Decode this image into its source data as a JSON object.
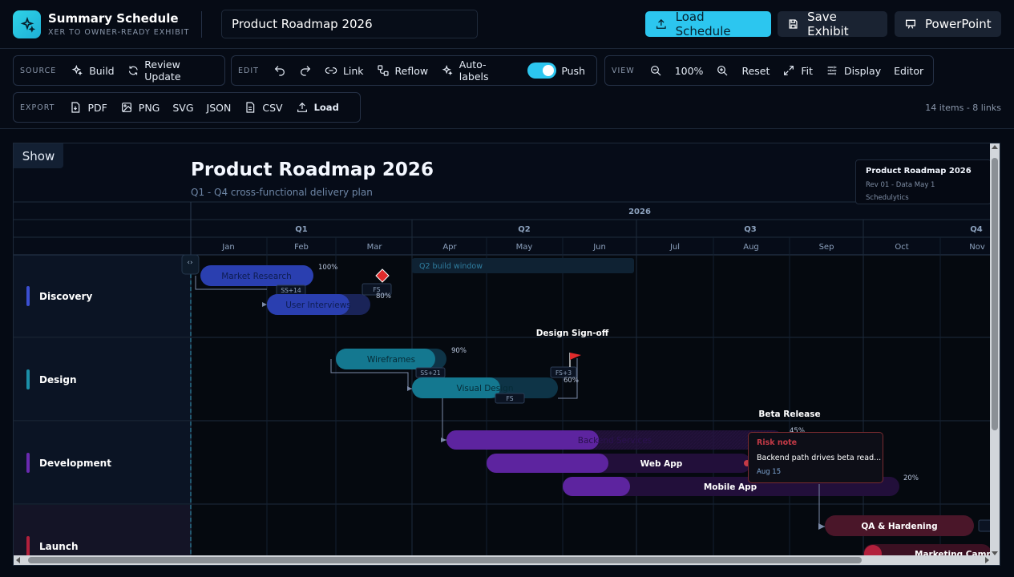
{
  "app": {
    "title": "Summary Schedule",
    "subtitle": "XER TO OWNER-READY EXHIBIT"
  },
  "header": {
    "title_value": "Product Roadmap 2026",
    "load_label": "Load Schedule",
    "save_label": "Save Exhibit",
    "ppt_label": "PowerPoint"
  },
  "toolbar": {
    "source": {
      "label": "SOURCE",
      "build": "Build",
      "review": "Review Update"
    },
    "edit": {
      "label": "EDIT",
      "link": "Link",
      "reflow": "Reflow",
      "autolabels": "Auto-labels",
      "push": "Push"
    },
    "view": {
      "label": "VIEW",
      "zoom": "100%",
      "reset": "Reset",
      "fit": "Fit",
      "display": "Display",
      "editor": "Editor"
    },
    "export": {
      "label": "EXPORT",
      "pdf": "PDF",
      "png": "PNG",
      "svg": "SVG",
      "json": "JSON",
      "csv": "CSV",
      "load": "Load"
    },
    "stats": "14 items - 8 links"
  },
  "canvas": {
    "show": "Show",
    "title": "Product Roadmap 2026",
    "subtitle": "Q1 - Q4 cross-functional delivery plan",
    "revbox": {
      "title": "Product Roadmap 2026",
      "rev": "Rev 01 - Data May 1",
      "org": "Schedulytics"
    }
  },
  "timeline": {
    "year": "2026",
    "quarters": [
      "Q1",
      "Q2",
      "Q3",
      "Q4"
    ],
    "months": [
      "Jan",
      "Feb",
      "Mar",
      "Apr",
      "May",
      "Jun",
      "Jul",
      "Aug",
      "Sep",
      "Oct",
      "Nov"
    ],
    "window_label": "Q2 build window"
  },
  "lanes": [
    {
      "name": "Discovery",
      "color": "#3b4fd1"
    },
    {
      "name": "Design",
      "color": "#1b8fa8"
    },
    {
      "name": "Development",
      "color": "#6a2ab0"
    },
    {
      "name": "Launch",
      "color": "#b2203c"
    }
  ],
  "tasks": [
    {
      "name": "Market Research",
      "progress": "100%"
    },
    {
      "name": "User Interviews",
      "progress": "80%"
    },
    {
      "name": "Wireframes",
      "progress": "90%"
    },
    {
      "name": "Visual Design",
      "progress": "60%"
    },
    {
      "name": "Backend Services",
      "progress": "45%"
    },
    {
      "name": "Web App",
      "progress": ""
    },
    {
      "name": "Mobile App",
      "progress": "20%"
    },
    {
      "name": "QA & Hardening",
      "progress": ""
    },
    {
      "name": "Marketing Campai",
      "progress": ""
    }
  ],
  "links": {
    "ss14": "SS+14",
    "fs1": "FS",
    "ss21": "SS+21",
    "fs3": "FS+3",
    "fs2": "FS"
  },
  "milestones": {
    "design": "Design Sign-off",
    "beta": "Beta Release"
  },
  "risk": {
    "title": "Risk note",
    "body": "Backend path drives beta read...",
    "date": "Aug 15"
  },
  "colors": {
    "accent": "#2cc6ef",
    "discovery": "#2c43b8",
    "design": "#137c93",
    "development": "#5d249f",
    "launch": "#4a1629",
    "risk": "#c53a47"
  }
}
